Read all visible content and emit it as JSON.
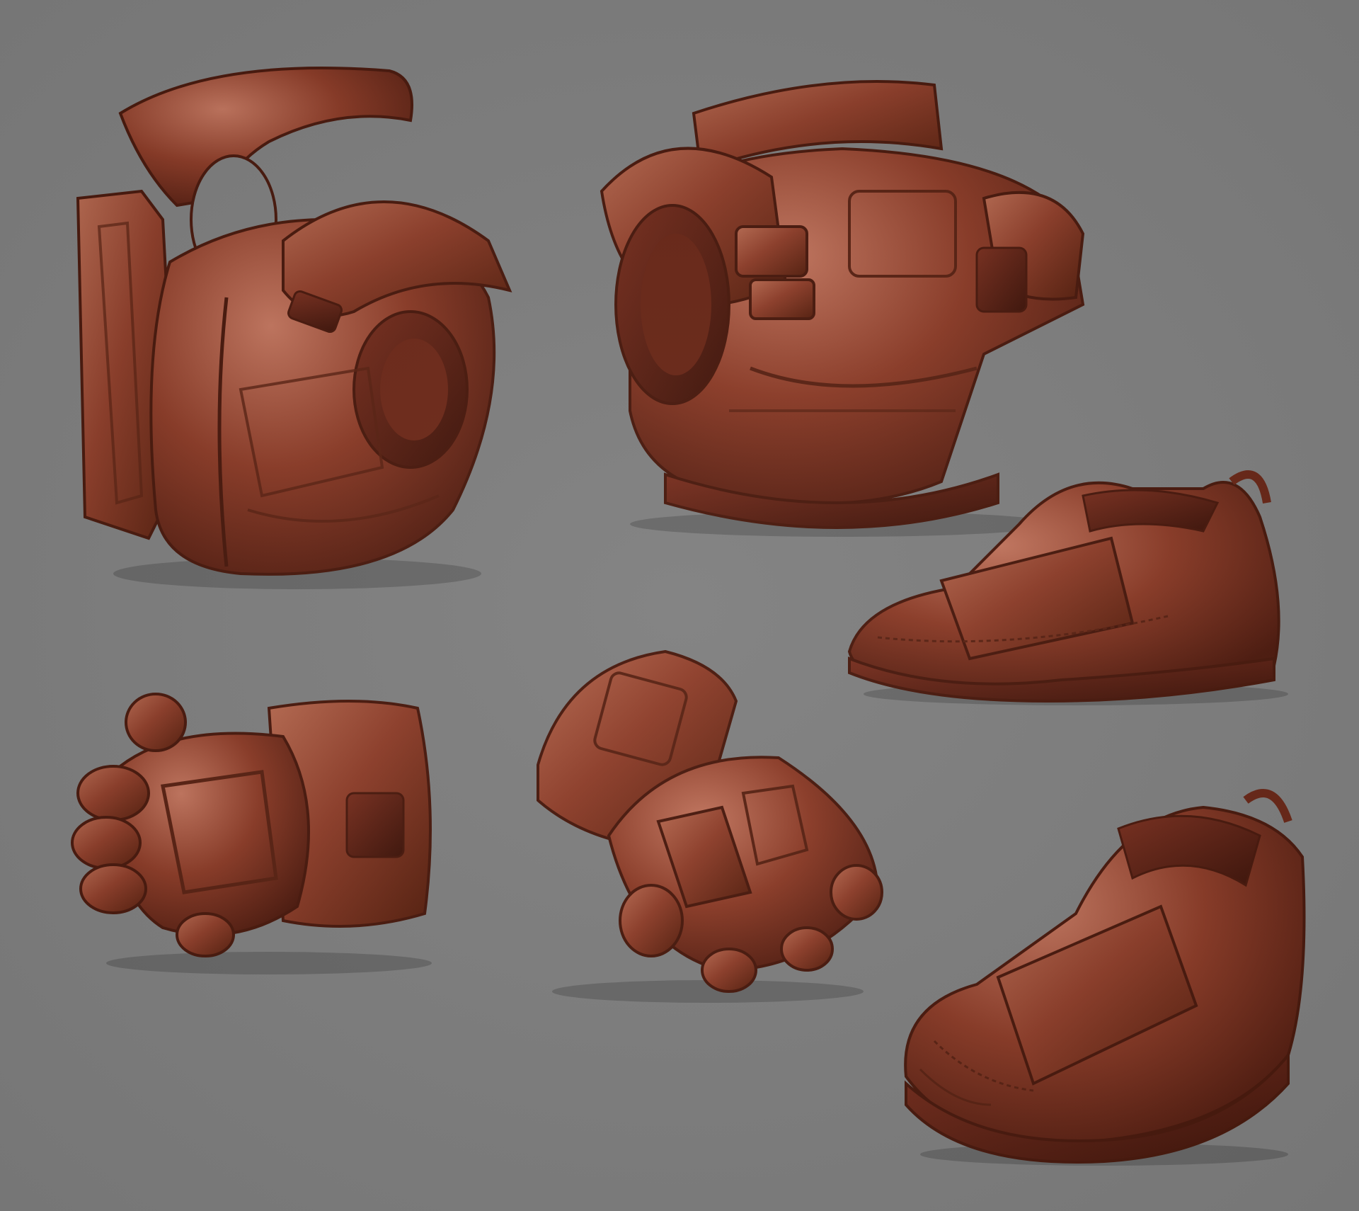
{
  "scene": {
    "background_color": "#808080",
    "clay_color": "#8a3b28",
    "clay_highlight": "#b56a50",
    "clay_shadow": "#4e1c12",
    "objects": [
      {
        "name": "jacket-side-view",
        "kind": "jacket"
      },
      {
        "name": "jacket-front-view",
        "kind": "jacket"
      },
      {
        "name": "shoe-side-view",
        "kind": "shoe"
      },
      {
        "name": "glove-back-view",
        "kind": "glove"
      },
      {
        "name": "glove-angled-view",
        "kind": "glove"
      },
      {
        "name": "shoe-angled-view",
        "kind": "shoe"
      }
    ]
  }
}
